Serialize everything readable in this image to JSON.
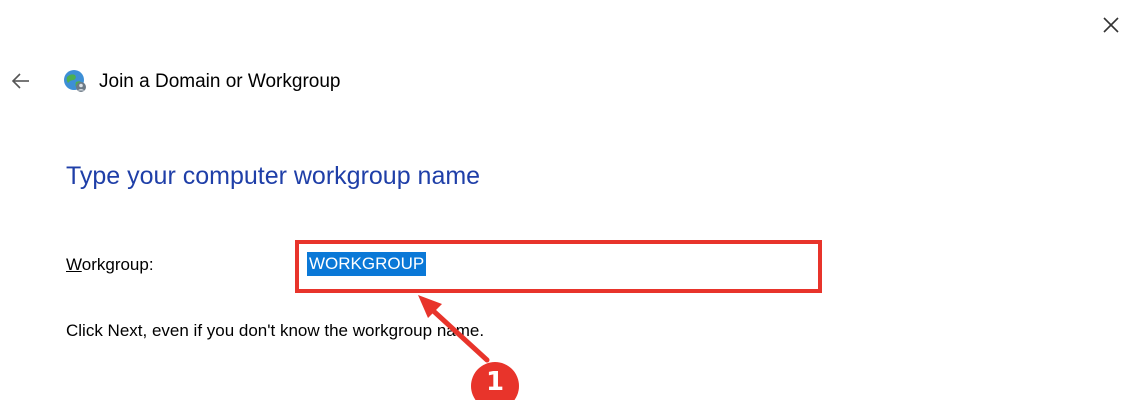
{
  "window": {
    "title": "Join a Domain or Workgroup",
    "close_icon": "close-icon",
    "back_icon": "back-arrow-icon",
    "app_icon": "network-globe-icon"
  },
  "main": {
    "heading": "Type your computer workgroup name",
    "workgroup_label_mnemonic": "W",
    "workgroup_label_rest": "orkgroup:",
    "workgroup_value": "WORKGROUP",
    "hint": "Click Next, even if you don't know the workgroup name."
  },
  "annotation": {
    "badge_number": "1",
    "color": "#e8342b"
  },
  "colors": {
    "heading": "#1f3fa8",
    "selection": "#0a78d7",
    "highlight_border": "#e8342b"
  }
}
